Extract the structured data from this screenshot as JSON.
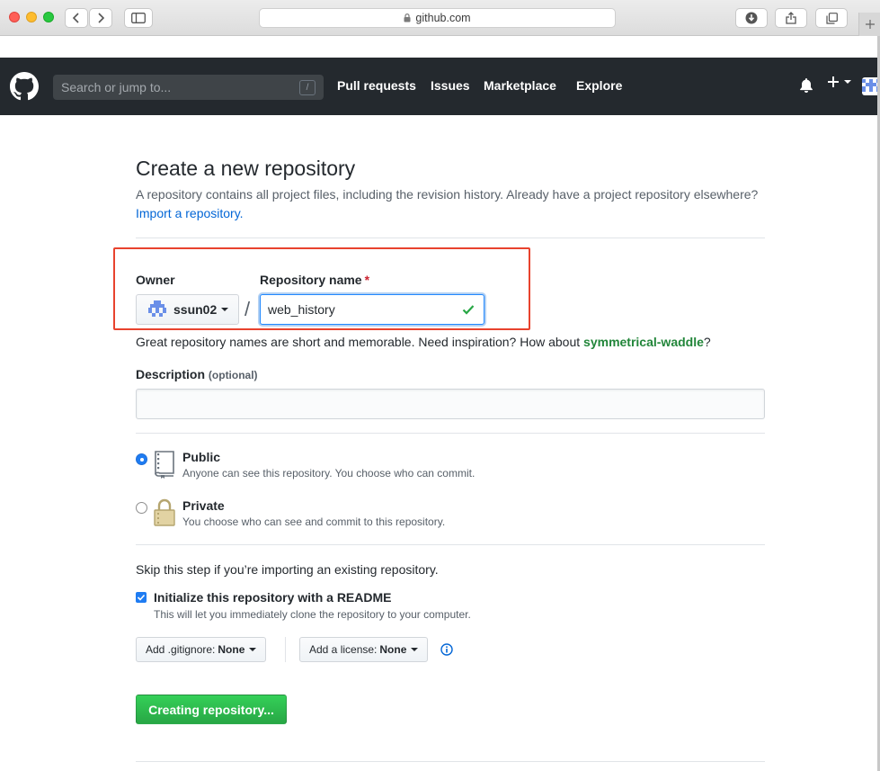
{
  "browser": {
    "url": "github.com"
  },
  "header": {
    "search_placeholder": "Search or jump to...",
    "search_shortcut": "/",
    "nav": [
      "Pull requests",
      "Issues",
      "Marketplace",
      "Explore"
    ],
    "plus_label": "+"
  },
  "page": {
    "title": "Create a new repository",
    "subtitle": "A repository contains all project files, including the revision history. Already have a project repository elsewhere?",
    "import_link": "Import a repository."
  },
  "form": {
    "owner_label": "Owner",
    "owner_value": "ssun02",
    "separator": "/",
    "repo_label": "Repository name",
    "required_mark": "*",
    "repo_value": "web_history",
    "hint_text": "Great repository names are short and memorable. Need inspiration? How about",
    "hint_suggestion": "symmetrical-waddle",
    "hint_end": "?",
    "desc_label": "Description",
    "desc_optional": "(optional)",
    "desc_value": "",
    "visibility": [
      {
        "title": "Public",
        "note": "Anyone can see this repository. You choose who can commit.",
        "selected": true
      },
      {
        "title": "Private",
        "note": "You choose who can see and commit to this repository.",
        "selected": false
      }
    ],
    "skip_text": "Skip this step if you’re importing an existing repository.",
    "init_title": "Initialize this repository with a README",
    "init_note": "This will let you immediately clone the repository to your computer.",
    "init_checked": true,
    "gitignore_label": "Add .gitignore:",
    "gitignore_value": "None",
    "license_label": "Add a license:",
    "license_value": "None",
    "submit_label": "Creating repository..."
  },
  "colors": {
    "header_bg": "#24292e",
    "accent": "#0366d6",
    "success": "#28a745",
    "highlight": "#e8432e"
  }
}
